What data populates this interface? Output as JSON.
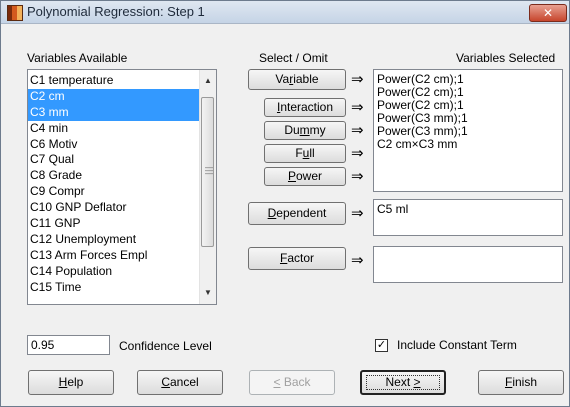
{
  "window": {
    "title": "Polynomial Regression: Step 1",
    "close_glyph": "✕"
  },
  "labels": {
    "variables_available": "Variables Available",
    "select_omit": "Select / Omit",
    "variables_selected": "Variables Selected",
    "confidence_level": "Confidence Level",
    "include_constant": "Include Constant Term"
  },
  "variables_available": [
    {
      "label": "C1 temperature",
      "selected": false
    },
    {
      "label": "C2 cm",
      "selected": true
    },
    {
      "label": "C3 mm",
      "selected": true
    },
    {
      "label": "C4 min",
      "selected": false
    },
    {
      "label": "C6 Motiv",
      "selected": false
    },
    {
      "label": "C7 Qual",
      "selected": false
    },
    {
      "label": "C8 Grade",
      "selected": false
    },
    {
      "label": "C9 Compr",
      "selected": false
    },
    {
      "label": "C10 GNP Deflator",
      "selected": false
    },
    {
      "label": "C11 GNP",
      "selected": false
    },
    {
      "label": "C12 Unemployment",
      "selected": false
    },
    {
      "label": "C13 Arm Forces Empl",
      "selected": false
    },
    {
      "label": "C14 Population",
      "selected": false
    },
    {
      "label": "C15 Time",
      "selected": false
    }
  ],
  "buttons": {
    "variable": {
      "pre": "Va",
      "key": "r",
      "post": "iable"
    },
    "interaction": {
      "pre": "",
      "key": "I",
      "post": "nteraction"
    },
    "dummy": {
      "pre": "Du",
      "key": "m",
      "post": "my"
    },
    "full": {
      "pre": "F",
      "key": "u",
      "post": "ll"
    },
    "power": {
      "pre": "",
      "key": "P",
      "post": "ower"
    },
    "dependent": {
      "pre": "",
      "key": "D",
      "post": "ependent"
    },
    "factor": {
      "pre": "",
      "key": "F",
      "post": "actor"
    },
    "help": {
      "pre": "",
      "key": "H",
      "post": "elp"
    },
    "cancel": {
      "pre": "",
      "key": "C",
      "post": "ancel"
    },
    "back": {
      "pre": "",
      "key": "<",
      "post": " Back"
    },
    "next": {
      "pre": "Next ",
      "key": ">",
      "post": ""
    },
    "finish": {
      "pre": "",
      "key": "F",
      "post": "inish"
    }
  },
  "arrow_glyph": "⇒",
  "variables_selected": [
    "Power(C2 cm);1",
    "Power(C2 cm);1",
    "Power(C2 cm);1",
    "Power(C3 mm);1",
    "Power(C3 mm);1",
    "C2 cm×C3 mm"
  ],
  "dependent_value": "C5 ml",
  "factor_value": "",
  "confidence_value": "0.95",
  "include_constant_checked": true,
  "check_glyph": "✓"
}
